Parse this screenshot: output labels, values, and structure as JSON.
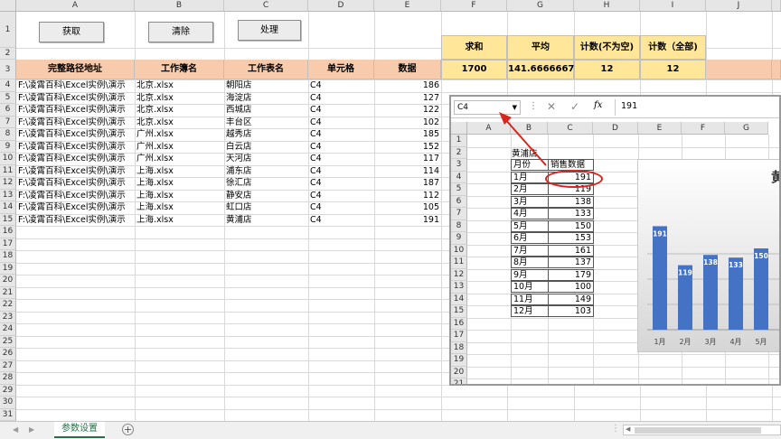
{
  "columns": [
    "A",
    "B",
    "C",
    "D",
    "E",
    "F",
    "G",
    "H",
    "I",
    "J"
  ],
  "rows": [
    "1",
    "2",
    "3",
    "4",
    "5",
    "6",
    "7",
    "8",
    "9",
    "10",
    "11",
    "12",
    "13",
    "14",
    "15",
    "16",
    "17",
    "18",
    "19",
    "20",
    "21",
    "22",
    "23",
    "24",
    "25",
    "26",
    "27",
    "28",
    "29",
    "30",
    "31"
  ],
  "buttons": {
    "fetch": "获取",
    "clear": "清除",
    "process": "处理"
  },
  "headers": [
    "完整路径地址",
    "工作簿名",
    "工作表名",
    "单元格",
    "数据"
  ],
  "summary": {
    "labels": [
      "求和",
      "平均",
      "计数(不为空)",
      "计数（全部)"
    ],
    "values": [
      "1700",
      "141.6666667",
      "12",
      "12"
    ]
  },
  "data_rows": [
    {
      "path": "F:\\凌霄百科\\Excel实例\\演示",
      "book": "北京.xlsx",
      "sheet": "朝阳店",
      "cell": "C4",
      "value": "186"
    },
    {
      "path": "F:\\凌霄百科\\Excel实例\\演示",
      "book": "北京.xlsx",
      "sheet": "海淀店",
      "cell": "C4",
      "value": "127"
    },
    {
      "path": "F:\\凌霄百科\\Excel实例\\演示",
      "book": "北京.xlsx",
      "sheet": "西城店",
      "cell": "C4",
      "value": "122"
    },
    {
      "path": "F:\\凌霄百科\\Excel实例\\演示",
      "book": "北京.xlsx",
      "sheet": "丰台区",
      "cell": "C4",
      "value": "102"
    },
    {
      "path": "F:\\凌霄百科\\Excel实例\\演示",
      "book": "广州.xlsx",
      "sheet": "越秀店",
      "cell": "C4",
      "value": "185"
    },
    {
      "path": "F:\\凌霄百科\\Excel实例\\演示",
      "book": "广州.xlsx",
      "sheet": "白云店",
      "cell": "C4",
      "value": "152"
    },
    {
      "path": "F:\\凌霄百科\\Excel实例\\演示",
      "book": "广州.xlsx",
      "sheet": "天河店",
      "cell": "C4",
      "value": "117"
    },
    {
      "path": "F:\\凌霄百科\\Excel实例\\演示",
      "book": "上海.xlsx",
      "sheet": "浦东店",
      "cell": "C4",
      "value": "114"
    },
    {
      "path": "F:\\凌霄百科\\Excel实例\\演示",
      "book": "上海.xlsx",
      "sheet": "徐汇店",
      "cell": "C4",
      "value": "187"
    },
    {
      "path": "F:\\凌霄百科\\Excel实例\\演示",
      "book": "上海.xlsx",
      "sheet": "静安店",
      "cell": "C4",
      "value": "112"
    },
    {
      "path": "F:\\凌霄百科\\Excel实例\\演示",
      "book": "上海.xlsx",
      "sheet": "虹口店",
      "cell": "C4",
      "value": "105"
    },
    {
      "path": "F:\\凌霄百科\\Excel实例\\演示",
      "book": "上海.xlsx",
      "sheet": "黄浦店",
      "cell": "C4",
      "value": "191"
    }
  ],
  "sheet_tab": "参数设置",
  "inner": {
    "name_box": "C4",
    "formula_value": "191",
    "fx_label": "fx",
    "columns": [
      "A",
      "B",
      "C",
      "D",
      "E",
      "F",
      "G"
    ],
    "rows": [
      "1",
      "2",
      "3",
      "4",
      "5",
      "6",
      "7",
      "8",
      "9",
      "10",
      "11",
      "12",
      "13",
      "14",
      "15",
      "16",
      "17",
      "18",
      "19",
      "20",
      "21"
    ],
    "store_name": "黄浦店",
    "table_header": [
      "月份",
      "销售数据"
    ],
    "table_rows": [
      [
        "1月",
        "191"
      ],
      [
        "2月",
        "119"
      ],
      [
        "3月",
        "138"
      ],
      [
        "4月",
        "133"
      ],
      [
        "5月",
        "150"
      ],
      [
        "6月",
        "153"
      ],
      [
        "7月",
        "161"
      ],
      [
        "8月",
        "137"
      ],
      [
        "9月",
        "179"
      ],
      [
        "10月",
        "100"
      ],
      [
        "11月",
        "149"
      ],
      [
        "12月",
        "103"
      ]
    ],
    "chart_title_partial": "黄"
  },
  "chart_data": {
    "type": "bar",
    "title": "黄",
    "categories": [
      "1月",
      "2月",
      "3月",
      "4月",
      "5月"
    ],
    "values": [
      191,
      119,
      138,
      133,
      150
    ],
    "bar_color": "#4472c4"
  }
}
